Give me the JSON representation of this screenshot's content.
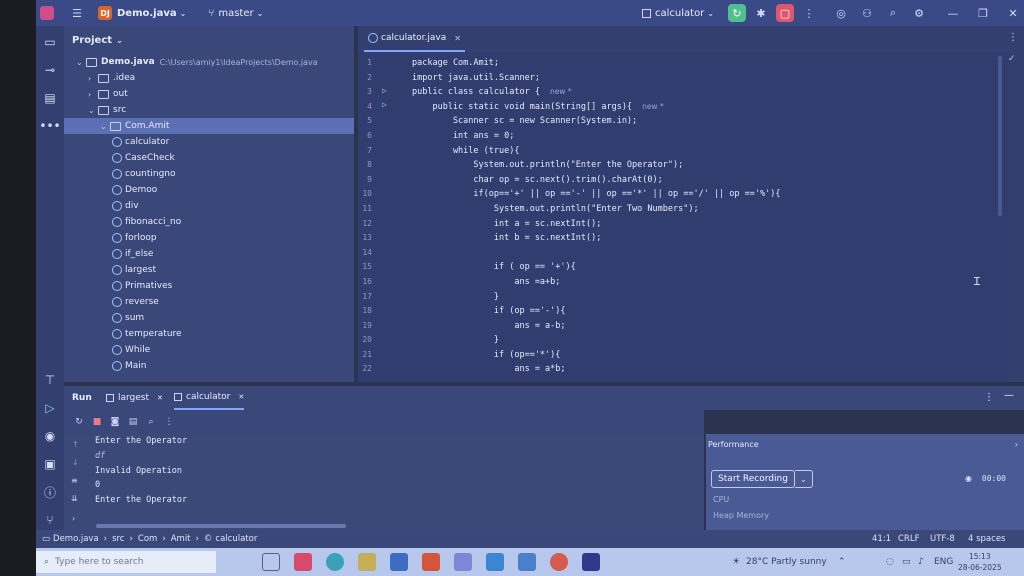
{
  "titlebar": {
    "project_badge": "DJ",
    "project_name": "Demo.java",
    "branch": "master",
    "run_config": "calculator"
  },
  "project_panel": {
    "title": "Project",
    "root_name": "Demo.java",
    "root_path": "C:\\Users\\amiy1\\IdeaProjects\\Demo.java",
    "folders": [
      ".idea",
      "out",
      "src"
    ],
    "package": "Com.Amit",
    "classes": [
      "calculator",
      "CaseCheck",
      "countingno",
      "Demoo",
      "div",
      "fibonacci_no",
      "forloop",
      "if_else",
      "largest",
      "Primatives",
      "reverse",
      "sum",
      "temperature",
      "While"
    ],
    "last_item": "Main"
  },
  "editor": {
    "tab": "calculator.java",
    "inlay_new": "new *",
    "line_numbers": [
      "1",
      "2",
      "3",
      "4",
      "5",
      "6",
      "7",
      "8",
      "9",
      "10",
      "11",
      "12",
      "13",
      "14",
      "15",
      "16",
      "17",
      "18",
      "19",
      "20",
      "21",
      "22"
    ],
    "lines": [
      "package Com.Amit;",
      "import java.util.Scanner;",
      "public class calculator {",
      "    public static void main(String[] args){",
      "        Scanner sc = new Scanner(System.in);",
      "        int ans = 0;",
      "        while (true){",
      "            System.out.println(\"Enter the Operator\");",
      "            char op = sc.next().trim().charAt(0);",
      "            if(op=='+' || op =='-' || op =='*' || op =='/' || op =='%'){",
      "                System.out.println(\"Enter Two Numbers\");",
      "                int a = sc.nextInt();",
      "                int b = sc.nextInt();",
      "",
      "                if ( op == '+'){",
      "                    ans =a+b;",
      "                }",
      "                if (op =='-'){",
      "                    ans = a-b;",
      "                }",
      "                if (op=='*'){",
      "                    ans = a*b;"
    ]
  },
  "run_panel": {
    "label": "Run",
    "tabs": [
      "largest",
      "calculator"
    ],
    "console": [
      {
        "text": "Enter the Operator",
        "input": false
      },
      {
        "text": "df",
        "input": true
      },
      {
        "text": "Invalid Operation",
        "input": false
      },
      {
        "text": "0",
        "input": false
      },
      {
        "text": "Enter the Operator",
        "input": false
      }
    ]
  },
  "performance": {
    "title": "Performance",
    "record_label": "Start Recording",
    "timer": "00:00",
    "cpu_label": "CPU",
    "heap_label": "Heap Memory"
  },
  "statusbar": {
    "breadcrumb": [
      "Demo.java",
      "src",
      "Com",
      "Amit",
      "calculator"
    ],
    "position": "41:1",
    "line_sep": "CRLF",
    "encoding": "UTF-8",
    "indent": "4 spaces"
  },
  "taskbar": {
    "search_placeholder": "Type here to search",
    "weather": "28°C  Partly sunny",
    "lang": "ENG",
    "time": "15:13",
    "date": "28-06-2025"
  }
}
